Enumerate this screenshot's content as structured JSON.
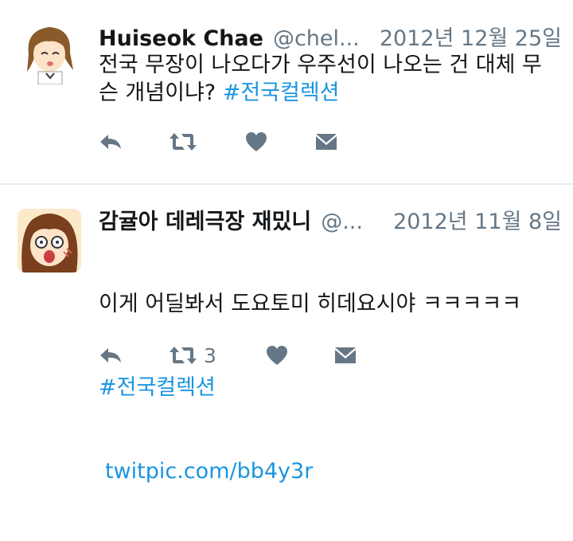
{
  "colors": {
    "text": "#14171a",
    "secondary": "#657786",
    "accent": "#1b95e0",
    "divider": "#e6ecf0",
    "icon": "#657786"
  },
  "tweets": [
    {
      "name": "Huiseok Chae",
      "handle": "@chel...",
      "date": "2012년 12월 25일",
      "text": "전국 무장이 나오다가 우주선이 나오는 건 대체 무슨 개념이냐? ",
      "hashtag": "#전국컬렉션",
      "avatar_icon": "anime-girl-avatar",
      "actions": {
        "reply": "reply-icon",
        "retweet": "retweet-icon",
        "like": "heart-icon",
        "message": "envelope-icon"
      }
    },
    {
      "name": "감귤아 데레극장 재밌니",
      "handle": "@...",
      "date": "2012년 11월 8일",
      "text": "이게 어딜봐서 도요토미 히데요시야 ㅋㅋㅋㅋㅋ",
      "hashtag": "#전국컬렉션",
      "link": "twitpic.com/bb4y3r",
      "retweet_count": "3",
      "avatar_icon": "anime-girl-shocked-avatar",
      "actions": {
        "reply": "reply-icon",
        "retweet": "retweet-icon",
        "like": "heart-icon",
        "message": "envelope-icon"
      }
    }
  ]
}
